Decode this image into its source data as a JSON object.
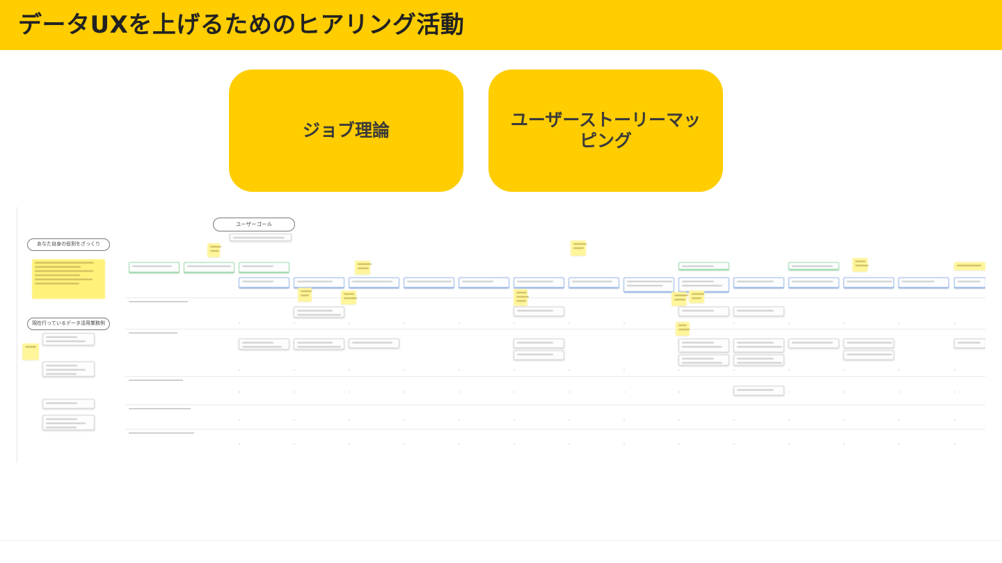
{
  "header": {
    "title": "データUXを上げるためのヒアリング活動"
  },
  "cards": [
    {
      "label": "ジョブ理論"
    },
    {
      "label": "ユーザーストーリーマッピング"
    }
  ],
  "board": {
    "user_goal": "ユーザーゴール",
    "role_label": "あなた自身の役割をざっくり",
    "cases_label": "現在行っているデータ活用業務例"
  },
  "colors": {
    "accent": "#FFCD00",
    "sticky": "#FFF59B",
    "note_border_blue": "#8fb1e8",
    "note_border_green": "#8fd8a3"
  }
}
